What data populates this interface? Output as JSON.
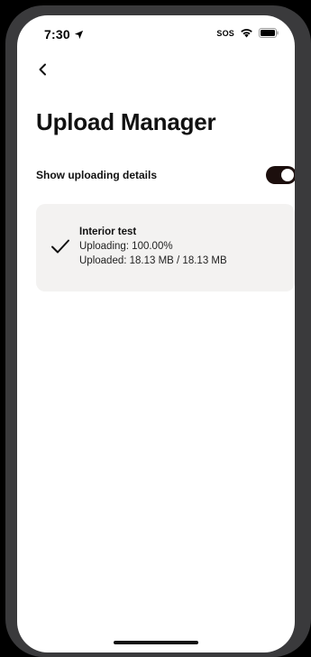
{
  "status_bar": {
    "time": "7:30",
    "sos": "SOS",
    "icons": [
      "location-arrow-icon",
      "wifi-icon",
      "battery-icon"
    ]
  },
  "nav": {
    "back_icon": "chevron-left-icon"
  },
  "page": {
    "title": "Upload Manager"
  },
  "settings": {
    "show_details_label": "Show uploading details",
    "show_details_enabled": true
  },
  "uploads": [
    {
      "name": "Interior test",
      "status_icon": "checkmark-icon",
      "progress_text": "Uploading: 100.00%",
      "size_text": "Uploaded: 18.13 MB / 18.13 MB"
    }
  ],
  "colors": {
    "toggle_on": "#1c0f0d",
    "card_bg": "#f3f2f1",
    "frame": "#3a3a3c"
  }
}
